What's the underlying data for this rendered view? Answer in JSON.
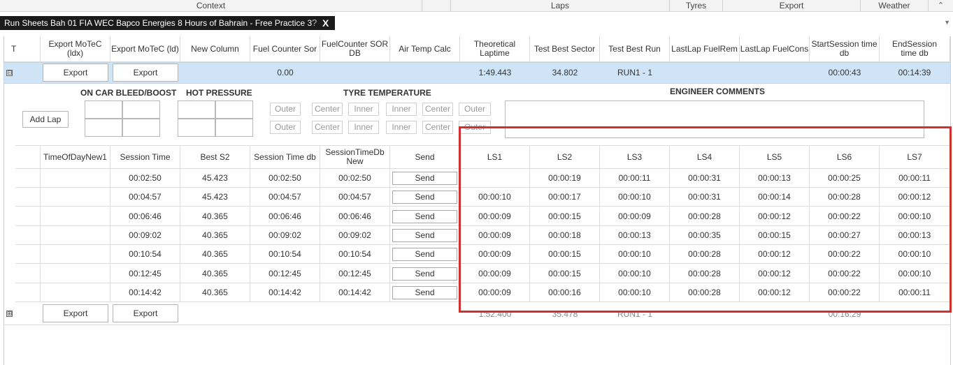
{
  "categories": [
    {
      "label": "Context"
    },
    {
      "label": ""
    },
    {
      "label": "Laps"
    },
    {
      "label": "Tyres"
    },
    {
      "label": "Export"
    },
    {
      "label": "Weather"
    }
  ],
  "collapse_icon": "chevron-up-icon",
  "document_tab": {
    "title": "Run Sheets Bah 01 FIA WEC Bapco Energies 8 Hours of Bahrain - Free Practice 3",
    "help": "?",
    "close": "X"
  },
  "main_header": {
    "first": "T",
    "columns": [
      "Export MoTeC (ldx)",
      "Export MoTeC (ld)",
      "New Column",
      "Fuel Counter Sor",
      "FuelCounter SOR DB",
      "Air Temp Calc",
      "Theoretical Laptime",
      "Test Best Sector",
      "Test Best Run",
      "LastLap FuelRem",
      "LastLap FuelCons",
      "StartSession time db",
      "EndSession time db"
    ]
  },
  "run1": {
    "expander": "⊟",
    "export_ldx": "Export",
    "export_ld": "Export",
    "fuel_counter_sor": "0.00",
    "theoretical_laptime": "1:49.443",
    "test_best_sector": "34.802",
    "test_best_run": "RUN1 - 1",
    "start_session": "00:00:43",
    "end_session": "00:14:39"
  },
  "detail_panel": {
    "add_lap": "Add Lap",
    "bleed_title": "ON CAR BLEED/BOOST",
    "hot_pressure_title": "HOT PRESSURE",
    "tyre_temp_title": "TYRE TEMPERATURE",
    "tyre_headers": [
      "Outer",
      "Center",
      "Inner",
      "Inner",
      "Center",
      "Outer"
    ],
    "engineer_title": "ENGINEER COMMENTS"
  },
  "lap_header": {
    "columns": [
      "TimeOfDayNew1",
      "Session Time",
      "Best S2",
      "Session Time db",
      "SessionTimeDbNew",
      "Send",
      "LS1",
      "LS2",
      "LS3",
      "LS4",
      "LS5",
      "LS6",
      "LS7"
    ]
  },
  "laps": [
    {
      "session_time": "00:02:50",
      "best_s2": "45.423",
      "session_time_db": "00:02:50",
      "session_time_db_new": "00:02:50",
      "send": "Send",
      "ls1": "",
      "ls2": "00:00:19",
      "ls3": "00:00:11",
      "ls4": "00:00:31",
      "ls5": "00:00:13",
      "ls6": "00:00:25",
      "ls7": "00:00:11"
    },
    {
      "session_time": "00:04:57",
      "best_s2": "45.423",
      "session_time_db": "00:04:57",
      "session_time_db_new": "00:04:57",
      "send": "Send",
      "ls1": "00:00:10",
      "ls2": "00:00:17",
      "ls3": "00:00:10",
      "ls4": "00:00:31",
      "ls5": "00:00:14",
      "ls6": "00:00:28",
      "ls7": "00:00:12"
    },
    {
      "session_time": "00:06:46",
      "best_s2": "40.365",
      "session_time_db": "00:06:46",
      "session_time_db_new": "00:06:46",
      "send": "Send",
      "ls1": "00:00:09",
      "ls2": "00:00:15",
      "ls3": "00:00:09",
      "ls4": "00:00:28",
      "ls5": "00:00:12",
      "ls6": "00:00:22",
      "ls7": "00:00:10"
    },
    {
      "session_time": "00:09:02",
      "best_s2": "40.365",
      "session_time_db": "00:09:02",
      "session_time_db_new": "00:09:02",
      "send": "Send",
      "ls1": "00:00:09",
      "ls2": "00:00:18",
      "ls3": "00:00:13",
      "ls4": "00:00:35",
      "ls5": "00:00:15",
      "ls6": "00:00:27",
      "ls7": "00:00:13"
    },
    {
      "session_time": "00:10:54",
      "best_s2": "40.365",
      "session_time_db": "00:10:54",
      "session_time_db_new": "00:10:54",
      "send": "Send",
      "ls1": "00:00:09",
      "ls2": "00:00:15",
      "ls3": "00:00:10",
      "ls4": "00:00:28",
      "ls5": "00:00:12",
      "ls6": "00:00:22",
      "ls7": "00:00:10"
    },
    {
      "session_time": "00:12:45",
      "best_s2": "40.365",
      "session_time_db": "00:12:45",
      "session_time_db_new": "00:12:45",
      "send": "Send",
      "ls1": "00:00:09",
      "ls2": "00:00:15",
      "ls3": "00:00:10",
      "ls4": "00:00:28",
      "ls5": "00:00:12",
      "ls6": "00:00:22",
      "ls7": "00:00:10"
    },
    {
      "session_time": "00:14:42",
      "best_s2": "40.365",
      "session_time_db": "00:14:42",
      "session_time_db_new": "00:14:42",
      "send": "Send",
      "ls1": "00:00:09",
      "ls2": "00:00:16",
      "ls3": "00:00:10",
      "ls4": "00:00:28",
      "ls5": "00:00:12",
      "ls6": "00:00:22",
      "ls7": "00:00:11"
    }
  ],
  "run2": {
    "expander": "⊞",
    "export_ldx": "Export",
    "export_ld": "Export",
    "theoretical_laptime": "1:52.400",
    "test_best_sector": "35.478",
    "test_best_run": "RUN1 - 1",
    "start_session": "00:16:29"
  },
  "colors": {
    "selected_row": "#cfe5f7",
    "highlight": "#d32f2f",
    "tab_bg": "#1b1b1b"
  }
}
